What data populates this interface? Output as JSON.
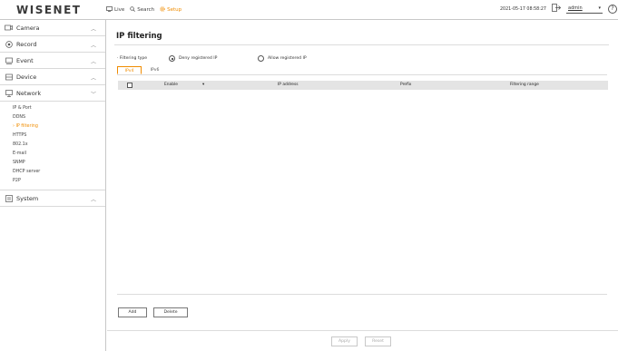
{
  "app": {
    "logo": "WISENET"
  },
  "topnav": {
    "live": "Live",
    "search": "Search",
    "setup": "Setup"
  },
  "status": {
    "datetime": "2021-05-17 08:58:27",
    "user": "admin"
  },
  "colors": {
    "accent": "#f08c00",
    "table_header": "#e4e4e4",
    "border": "#c8c8c8"
  },
  "sidebar": {
    "camera": "Camera",
    "record": "Record",
    "event": "Event",
    "device": "Device",
    "network": "Network",
    "network_items": [
      "IP & Port",
      "DDNS",
      "IP filtering",
      "HTTPS",
      "802.1x",
      "E-mail",
      "SNMP",
      "DHCP server",
      "P2P"
    ],
    "system": "System"
  },
  "page": {
    "title": "IP filtering",
    "filtering_type_label": "Filtering type",
    "deny_label": "Deny registered IP",
    "allow_label": "Allow registered IP",
    "tabs": [
      "IPv4",
      "IPv6"
    ],
    "columns": {
      "enable": "Enable",
      "ip_address": "IP address",
      "prefix": "Prefix",
      "range": "Filtering range"
    },
    "add": "Add",
    "delete": "Delete",
    "apply": "Apply",
    "reset": "Reset"
  }
}
